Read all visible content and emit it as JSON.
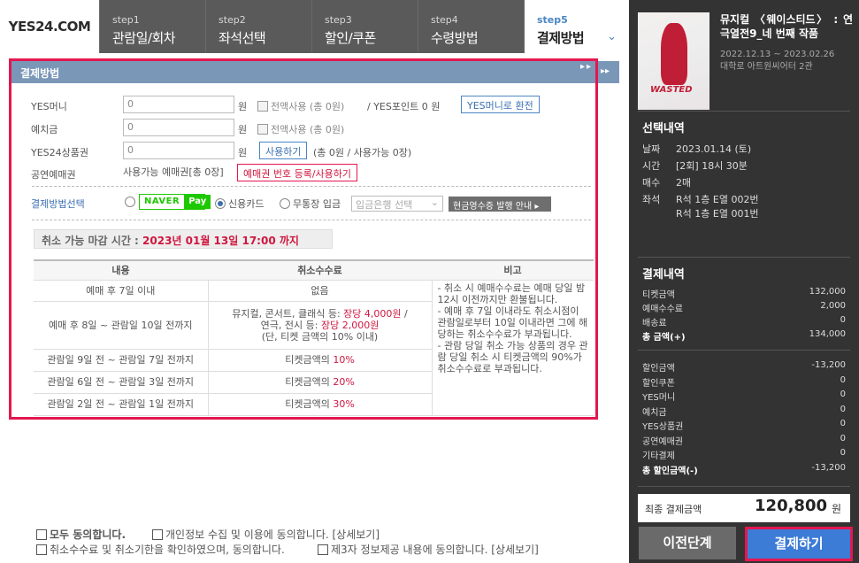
{
  "logo": "YES24.COM",
  "steps": [
    {
      "n": "step1",
      "t": "관람일/회차"
    },
    {
      "n": "step2",
      "t": "좌석선택"
    },
    {
      "n": "step3",
      "t": "할인/쿠폰"
    },
    {
      "n": "step4",
      "t": "수령방법"
    },
    {
      "n": "step5",
      "t": "결제방법"
    }
  ],
  "show": {
    "title": "뮤지컬 〈웨이스티드〉 : 연극열전9_네 번째 작품",
    "period": "2022.12.13 ~ 2023.02.26",
    "venue": "대학로 아트원씨어터 2관",
    "poster_text": "WASTED"
  },
  "selection": {
    "heading": "선택내역",
    "rows": [
      {
        "k": "날짜",
        "v": "2023.01.14 (토)"
      },
      {
        "k": "시간",
        "v": "[2회] 18시 30분"
      },
      {
        "k": "매수",
        "v": "2매"
      },
      {
        "k": "좌석",
        "v": "R석 1층 E열 002번"
      }
    ],
    "seat2": "R석 1층 E열 001번"
  },
  "payment_summary": {
    "heading": "결제내역",
    "rows": [
      {
        "k": "티켓금액",
        "v": "132,000"
      },
      {
        "k": "예매수수료",
        "v": "2,000"
      },
      {
        "k": "배송료",
        "v": "0"
      }
    ],
    "total_label": "총 금액(+)",
    "total": "134,000",
    "discounts": [
      {
        "k": "할인금액",
        "v": "-13,200"
      },
      {
        "k": "할인쿠폰",
        "v": "0"
      },
      {
        "k": "YES머니",
        "v": "0"
      },
      {
        "k": "예치금",
        "v": "0"
      },
      {
        "k": "YES상품권",
        "v": "0"
      },
      {
        "k": "공연예매권",
        "v": "0"
      },
      {
        "k": "기타결제",
        "v": "0"
      }
    ],
    "discount_total_label": "총 할인금액(-)",
    "discount_total": "-13,200",
    "final_label": "최종 결제금액",
    "final_amount": "120,800",
    "final_unit": "원"
  },
  "buttons": {
    "prev": "이전단계",
    "pay": "결제하기"
  },
  "method": {
    "heading": "결제방법",
    "yesmoney": {
      "label": "YES머니",
      "value": "0",
      "unit": "원",
      "use_all": "전액사용 (총 0원)",
      "points": "/ YES포인트 0 원",
      "convert": "YES머니로 환전"
    },
    "deposit": {
      "label": "예치금",
      "value": "0",
      "unit": "원",
      "use_all": "전액사용 (총 0원)"
    },
    "giftcard": {
      "label": "YES24상품권",
      "value": "0",
      "unit": "원",
      "use": "사용하기",
      "info": "(총 0원 / 사용가능 0장)"
    },
    "voucher": {
      "label": "공연예매권",
      "info": "사용가능 예매권[총 0장]",
      "register": "예매권 번호 등록/사용하기"
    },
    "select": {
      "label": "결제방법선택",
      "naver_a": "NAVER",
      "naver_b": "Pay",
      "card": "신용카드",
      "bank": "무통장 입금",
      "bank_select": "입금은행 선택",
      "receipt": "현금영수증 발행 안내"
    },
    "cancel": {
      "label": "취소 가능 마감 시간 : ",
      "deadline": "2023년 01월 13일 17:00 까지"
    },
    "table": {
      "headers": [
        "내용",
        "취소수수료",
        "비고"
      ],
      "rows": [
        {
          "c": "예매 후 7일 이내",
          "f": "없음"
        },
        {
          "c": "예매 후 8일 ~ 관람일 10일 전까지",
          "f1": "뮤지컬, 콘서트, 클래식 등: ",
          "f1r": "장당 4,000원",
          "f1e": " /",
          "f2": "연극, 전시 등: ",
          "f2r": "장당 2,000원",
          "f3": "(단, 티켓 금액의 10% 이내)"
        },
        {
          "c": "관람일 9일 전 ~ 관람일 7일 전까지",
          "f": "티켓금액의 ",
          "fr": "10%"
        },
        {
          "c": "관람일 6일 전 ~ 관람일 3일 전까지",
          "f": "티켓금액의 ",
          "fr": "20%"
        },
        {
          "c": "관람일 2일 전 ~ 관람일 1일 전까지",
          "f": "티켓금액의 ",
          "fr": "30%"
        }
      ],
      "note": "- 취소 시 예매수수료는 예매 당일 밤 12시 이전까지만 환불됩니다.\n- 예매 후 7일 이내라도 취소시점이 관람일로부터 10일 이내라면 그에 해당하는 취소수수료가 부과됩니다.\n- 관람 당일 취소 가능 상품의 경우 관람 당일 취소 시 티켓금액의 90%가 취소수수료로 부과됩니다."
    }
  },
  "agree": {
    "all": "모두 동의합니다.",
    "privacy": "개인정보 수집 및 이용에 동의합니다. [상세보기]",
    "fee": "취소수수료 및 취소기한을 확인하였으며, 동의합니다.",
    "third": "제3자 정보제공 내용에 동의합니다. [상세보기]"
  }
}
